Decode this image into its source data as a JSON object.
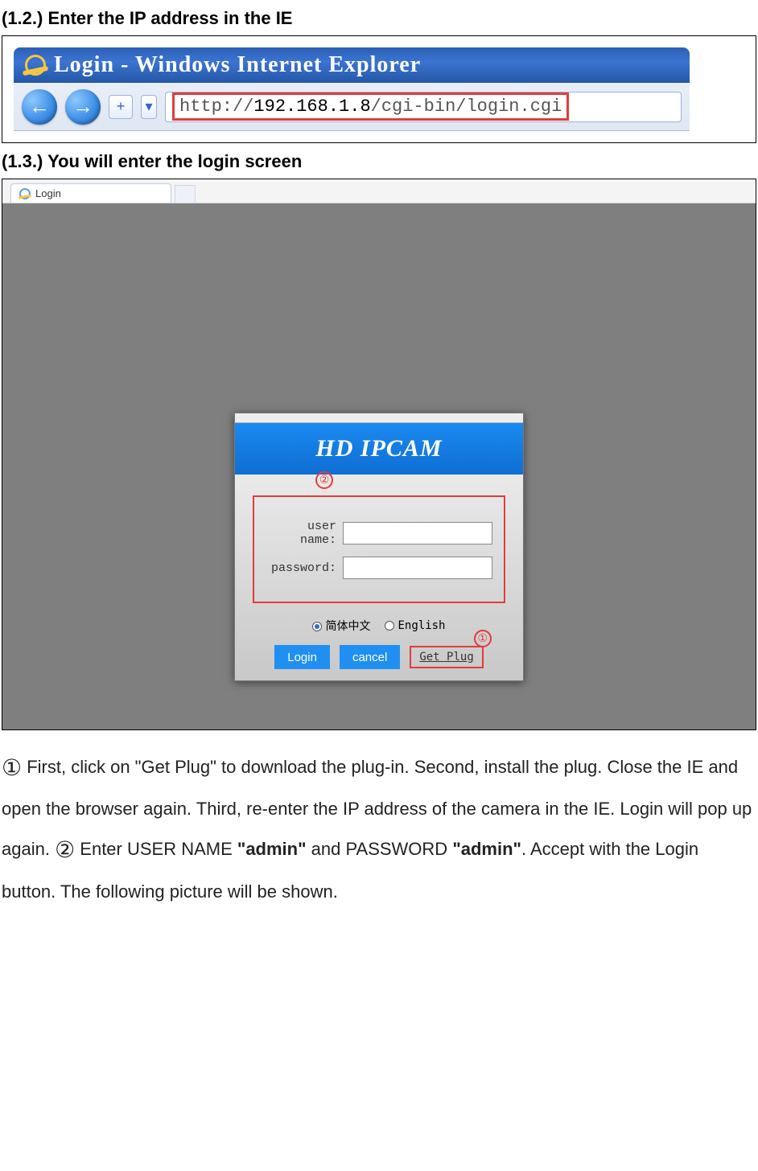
{
  "headings": {
    "h12": "(1.2.) Enter the IP address in the IE",
    "h13": "(1.3.) You will enter the login screen"
  },
  "ie": {
    "title": "Login - Windows Internet Explorer",
    "url_left": "http://",
    "url_mid": "192.168.1.8",
    "url_right": "/cgi-bin/login.cgi"
  },
  "tab": {
    "label": "Login"
  },
  "login": {
    "banner": "HD IPCAM",
    "user_label": "user name:",
    "pass_label": "password:",
    "lang_cn": "简体中文",
    "lang_en": "English",
    "btn_login": "Login",
    "btn_cancel": "cancel",
    "get_plug": "Get Plug",
    "badge1": "①",
    "badge2": "②"
  },
  "para": {
    "c1": "①",
    "t1": " First, click on \"Get Plug\" to download the plug-in. Second, install the plug. Close the IE and open the browser again. Third, re-enter the IP address of the camera in the IE. Login will pop up again. ",
    "c2": "②",
    "t2": " Enter USER NAME ",
    "b1": "\"admin\"",
    "t3": " and PASSWORD ",
    "b2": "\"admin\"",
    "t4": ". Accept with the Login button. The following picture will be shown."
  }
}
